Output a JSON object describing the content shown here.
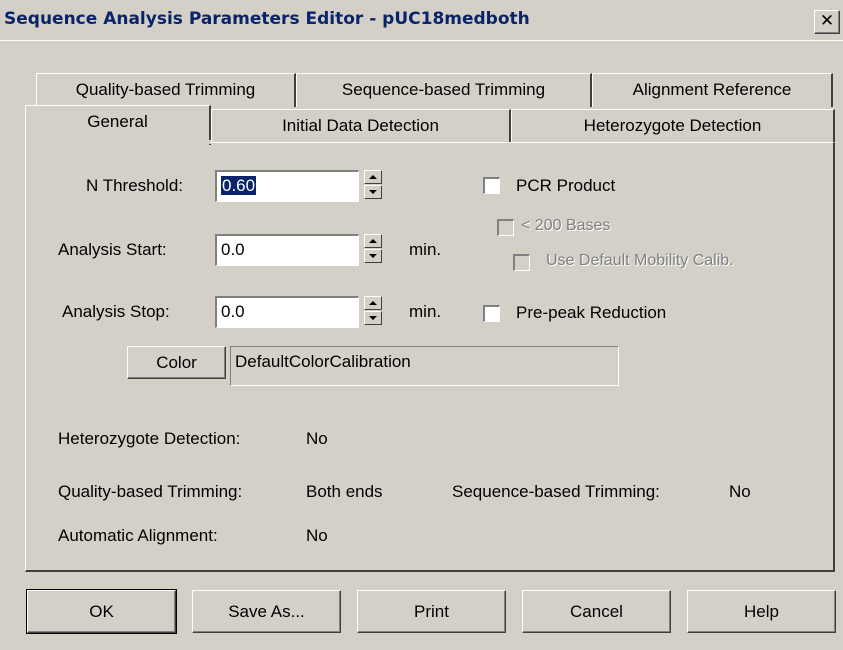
{
  "window": {
    "title": "Sequence Analysis Parameters Editor - pUC18medboth",
    "close_glyph": "✕"
  },
  "tabs": {
    "row_back": [
      "Quality-based Trimming",
      "Sequence-based Trimming",
      "Alignment Reference"
    ],
    "row_front": [
      "General",
      "Initial Data Detection",
      "Heterozygote Detection"
    ],
    "active": "General"
  },
  "general": {
    "n_threshold": {
      "label": "N Threshold:",
      "value": "0.60"
    },
    "analysis_start": {
      "label": "Analysis Start:",
      "value": "0.0",
      "unit": "min."
    },
    "analysis_stop": {
      "label": "Analysis Stop:",
      "value": "0.0",
      "unit": "min."
    },
    "pcr_product": {
      "label": "PCR Product",
      "checked": false
    },
    "under_200": {
      "label": "< 200 Bases",
      "checked": false,
      "enabled": false
    },
    "default_mobility": {
      "label": "Use Default Mobility Calib.",
      "checked": false,
      "enabled": false
    },
    "prepeak": {
      "label": "Pre-peak Reduction",
      "checked": false
    },
    "color_button": "Color",
    "color_value": "DefaultColorCalibration",
    "summary": {
      "het_label": "Heterozygote Detection:",
      "het_value": "No",
      "qual_label": "Quality-based Trimming:",
      "qual_value": "Both ends",
      "seq_label": "Sequence-based Trimming:",
      "seq_value": "No",
      "align_label": "Automatic Alignment:",
      "align_value": "No"
    }
  },
  "buttons": {
    "ok": "OK",
    "save_as": "Save As...",
    "print": "Print",
    "cancel": "Cancel",
    "help": "Help"
  }
}
